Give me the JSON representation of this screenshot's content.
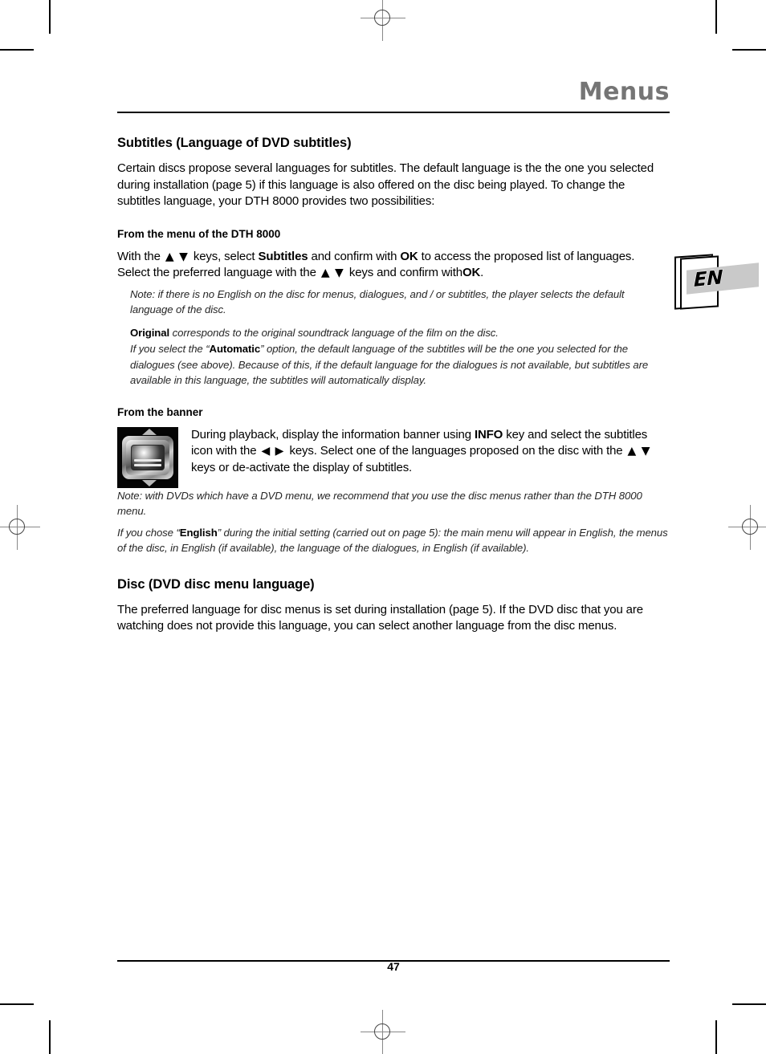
{
  "header": {
    "title": "Menus"
  },
  "language_tab": {
    "label": "EN"
  },
  "sections": {
    "subtitles": {
      "heading": "Subtitles (Language of DVD subtitles)",
      "intro": "Certain discs propose several languages for subtitles. The default language is the the one you selected during installation (page 5) if this language is also offered on the disc being played. To change the subtitles language, your DTH 8000 provides two possibilities:",
      "from_menu": {
        "heading": "From the menu of the DTH 8000",
        "line_a": "With the",
        "line_b": "keys, select",
        "bold_subtitles": "Subtitles",
        "line_c": "and confirm with",
        "bold_ok_1": "OK",
        "line_d": "to access the proposed list of languages. Select the preferred language with the",
        "line_e": "keys and confirm with",
        "bold_ok_2": "OK",
        "line_f": ".",
        "note_1": "Note: if there is no English on the disc for menus, dialogues, and / or subtitles, the player selects the default language of the disc.",
        "note_2_bold": "Original",
        "note_2": "corresponds to the original soundtrack language of the film on the disc.",
        "note_3_pre": "If you select the “",
        "note_3_bold": "Automatic",
        "note_3_post": "” option, the default language of the subtitles will be the one you selected for the dialogues (see above). Because of this, if the default language for the dialogues is not available, but subtitles are available in this language, the subtitles will automatically display."
      },
      "from_banner": {
        "heading": "From the banner",
        "icon_name": "subtitles-banner-icon",
        "text_a": "During playback, display the information banner using",
        "bold_info": "INFO",
        "text_b": "key and select the subtitles icon with the",
        "text_c": "keys. Select one of the languages proposed on the disc with the",
        "text_d": "keys or de-activate the display of subtitles.",
        "note_1": "Note: with DVDs which have a DVD menu, we recommend that you use the disc menus rather than the DTH 8000 menu.",
        "note_2_pre": "If you chose “",
        "note_2_bold": "English",
        "note_2_post": "” during the initial setting (carried out on page 5): the main menu will appear in English, the menus of the disc, in English (if available), the language of the dialogues, in English (if available)."
      }
    },
    "disc": {
      "heading": "Disc (DVD disc menu language)",
      "body": "The preferred language for disc menus is set during installation (page 5). If the DVD disc that you are watching does not provide this language, you can select another language from the disc menus."
    }
  },
  "arrows": {
    "up_down": "▲ ▼",
    "left_right": "◀ ▶"
  },
  "footer": {
    "page_number": "47"
  }
}
